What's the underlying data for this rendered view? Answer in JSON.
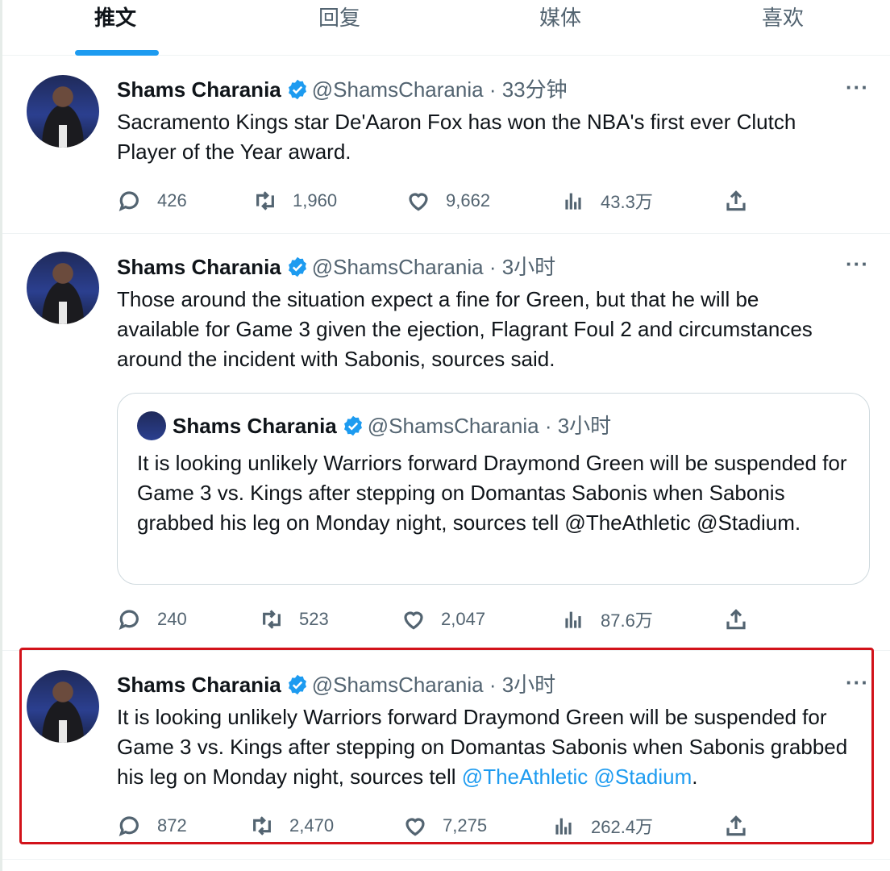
{
  "tabs": [
    "推文",
    "回复",
    "媒体",
    "喜欢"
  ],
  "tweets": [
    {
      "name": "Shams Charania",
      "handle": "@ShamsCharania",
      "time": "· 33分钟",
      "text": "Sacramento Kings star De'Aaron Fox has won the NBA's first ever Clutch Player of the Year award.",
      "replies": "426",
      "retweets": "1,960",
      "likes": "9,662",
      "views": "43.3万"
    },
    {
      "name": "Shams Charania",
      "handle": "@ShamsCharania",
      "time": "· 3小时",
      "text": "Those around the situation expect a fine for Green, but that he will be available for Game 3 given the ejection, Flagrant Foul 2 and circumstances around the incident with Sabonis, sources said.",
      "quote": {
        "name": "Shams Charania",
        "handle": "@ShamsCharania",
        "time": "· 3小时",
        "text": "It is looking unlikely Warriors forward Draymond Green will be suspended for Game 3 vs. Kings after stepping on Domantas Sabonis when Sabonis grabbed his leg on Monday night, sources tell @TheAthletic @Stadium."
      },
      "replies": "240",
      "retweets": "523",
      "likes": "2,047",
      "views": "87.6万"
    },
    {
      "name": "Shams Charania",
      "handle": "@ShamsCharania",
      "time": "· 3小时",
      "text": "It is looking unlikely Warriors forward Draymond Green will be suspended for Game 3 vs. Kings after stepping on Domantas Sabonis when Sabonis grabbed his leg on Monday night, sources tell ",
      "mention1": "@TheAthletic",
      "mention2": "@Stadium",
      "end": ".",
      "replies": "872",
      "retweets": "2,470",
      "likes": "7,275",
      "views": "262.4万"
    }
  ],
  "more_label": "···",
  "colors": {
    "accent": "#1d9bf0",
    "highlight": "#d2121a",
    "muted": "#536471"
  }
}
